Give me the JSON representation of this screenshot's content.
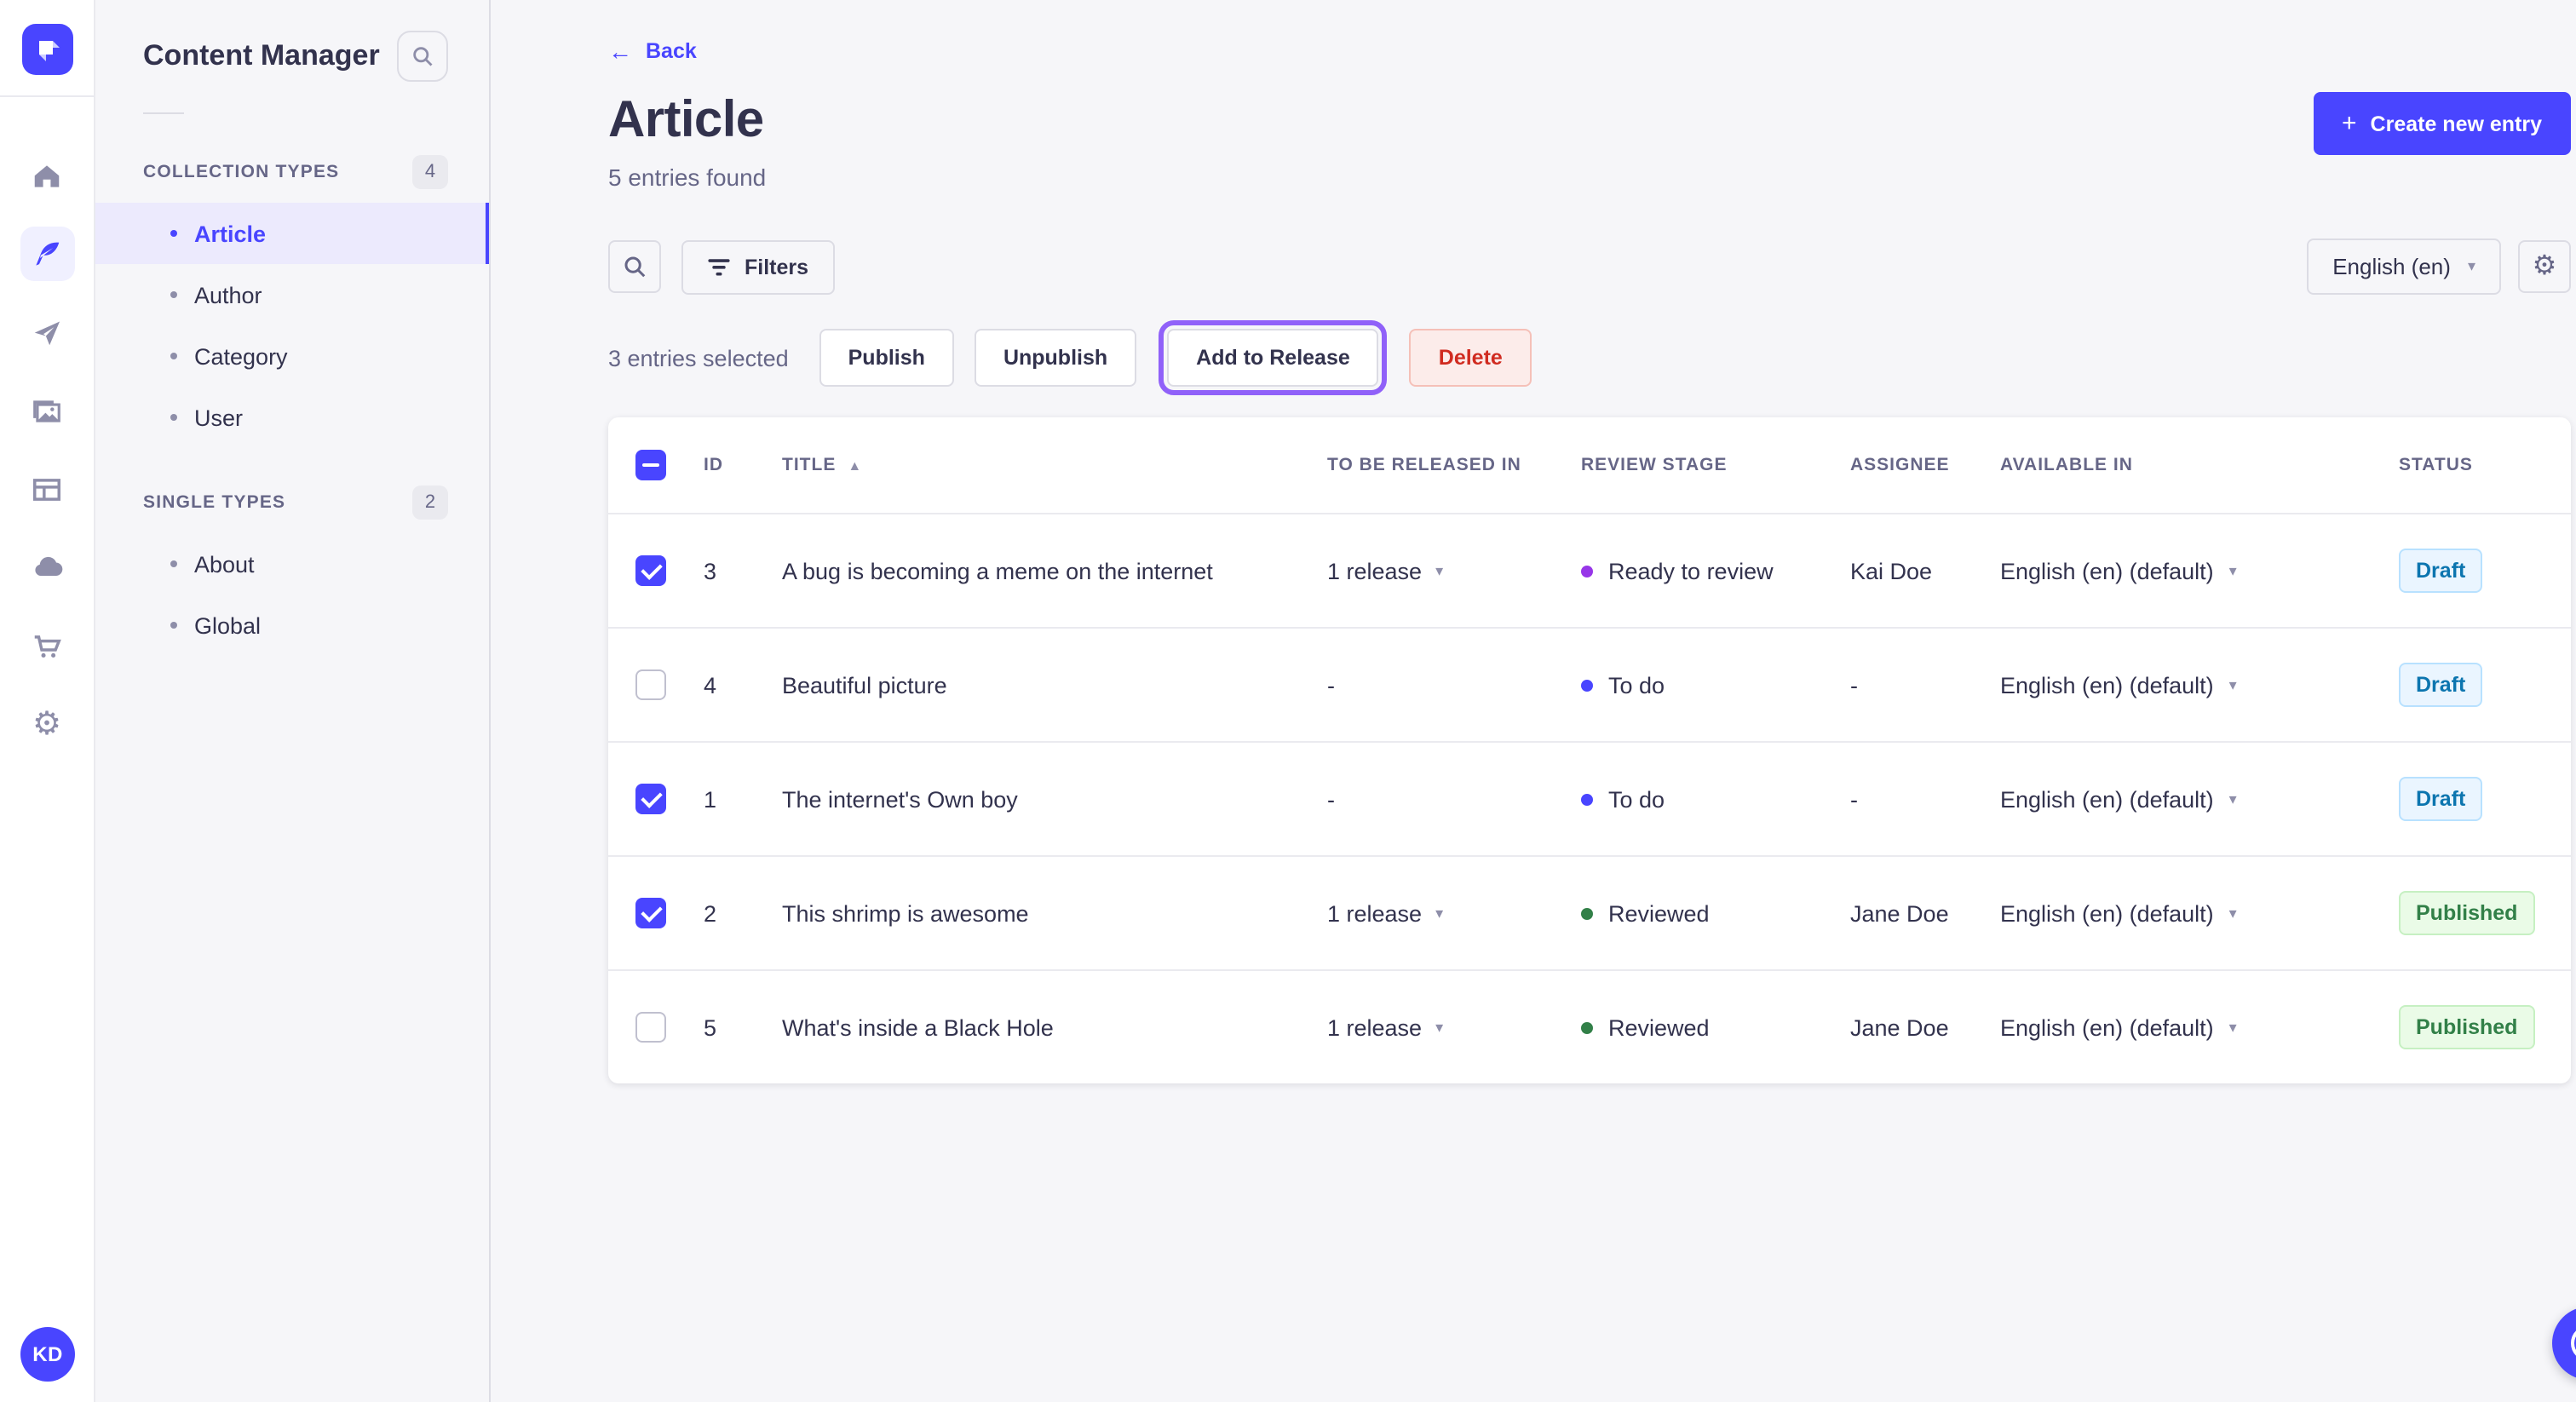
{
  "colors": {
    "primary": "#4945ff",
    "highlight_ring": "#9061f9",
    "danger_text": "#d02b20",
    "stage_ready": "#9736e8",
    "stage_todo": "#4945ff",
    "stage_reviewed": "#328048"
  },
  "icons": {
    "back_arrow": "←",
    "plus": "+",
    "chevron_down": "▾",
    "sort_asc": "▲",
    "gear": "⚙",
    "question": "?"
  },
  "rail": {
    "items": [
      {
        "name": "home"
      },
      {
        "name": "content-manager",
        "active": true
      },
      {
        "name": "releases"
      },
      {
        "name": "media-library"
      },
      {
        "name": "content-type-builder"
      },
      {
        "name": "deploy"
      },
      {
        "name": "marketplace"
      },
      {
        "name": "settings"
      }
    ]
  },
  "user": {
    "initials": "KD"
  },
  "sidebar": {
    "title": "Content Manager",
    "sections": [
      {
        "label": "COLLECTION TYPES",
        "count": "4",
        "items": [
          {
            "label": "Article",
            "active": true
          },
          {
            "label": "Author"
          },
          {
            "label": "Category"
          },
          {
            "label": "User"
          }
        ]
      },
      {
        "label": "SINGLE TYPES",
        "count": "2",
        "items": [
          {
            "label": "About"
          },
          {
            "label": "Global"
          }
        ]
      }
    ]
  },
  "header": {
    "back_label": "Back",
    "title": "Article",
    "subtitle": "5 entries found",
    "create_button_label": "Create new entry"
  },
  "toolbar": {
    "filters_label": "Filters",
    "locale_value": "English (en)"
  },
  "selection": {
    "text": "3 entries selected",
    "publish_label": "Publish",
    "unpublish_label": "Unpublish",
    "add_to_release_label": "Add to Release",
    "delete_label": "Delete"
  },
  "table": {
    "columns": {
      "id": "ID",
      "title": "TITLE",
      "released": "TO BE RELEASED IN",
      "review": "REVIEW STAGE",
      "assignee": "ASSIGNEE",
      "available": "AVAILABLE IN",
      "status": "STATUS"
    },
    "rows": [
      {
        "checked": true,
        "id": "3",
        "title": "A bug is becoming a meme on the internet",
        "release": "1 release",
        "stage": "Ready to review",
        "assignee": "Kai Doe",
        "available": "English (en) (default)",
        "status": "Draft"
      },
      {
        "checked": false,
        "id": "4",
        "title": "Beautiful picture",
        "release": "-",
        "stage": "To do",
        "assignee": "-",
        "available": "English (en) (default)",
        "status": "Draft"
      },
      {
        "checked": true,
        "id": "1",
        "title": "The internet's Own boy",
        "release": "-",
        "stage": "To do",
        "assignee": "-",
        "available": "English (en) (default)",
        "status": "Draft"
      },
      {
        "checked": true,
        "id": "2",
        "title": "This shrimp is awesome",
        "release": "1 release",
        "stage": "Reviewed",
        "assignee": "Jane Doe",
        "available": "English (en) (default)",
        "status": "Published"
      },
      {
        "checked": false,
        "id": "5",
        "title": "What's inside a Black Hole",
        "release": "1 release",
        "stage": "Reviewed",
        "assignee": "Jane Doe",
        "available": "English (en) (default)",
        "status": "Published"
      }
    ]
  }
}
